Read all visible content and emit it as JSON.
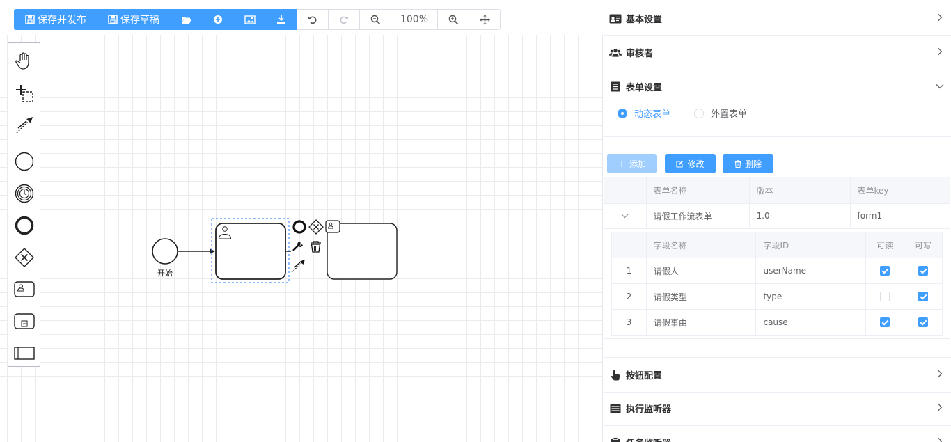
{
  "toolbar": {
    "save_publish": "保存并发布",
    "save_draft": "保存草稿",
    "zoom": "100%"
  },
  "palette": {
    "items": [
      "hand-tool",
      "lasso-tool",
      "connect-tool",
      "start-event",
      "timer-event",
      "end-event",
      "gateway",
      "user-task",
      "sub-process",
      "pool"
    ]
  },
  "diagram": {
    "start_label": "开始"
  },
  "panel": {
    "basic": "基本设置",
    "reviewer": "审核者",
    "form_settings": "表单设置",
    "radio_dynamic": "动态表单",
    "radio_external": "外置表单",
    "btn_add": "添加",
    "btn_edit": "修改",
    "btn_delete": "删除",
    "form_table": {
      "headers": [
        "表单名称",
        "版本",
        "表单key"
      ],
      "row": {
        "name": "请假工作流表单",
        "version": "1.0",
        "key": "form1"
      }
    },
    "field_table": {
      "headers": [
        "字段名称",
        "字段ID",
        "可读",
        "可写"
      ],
      "rows": [
        {
          "idx": "1",
          "name": "请假人",
          "id": "userName",
          "read": true,
          "write": true
        },
        {
          "idx": "2",
          "name": "请假类型",
          "id": "type",
          "read": false,
          "write": true
        },
        {
          "idx": "3",
          "name": "请假事由",
          "id": "cause",
          "read": true,
          "write": true
        }
      ]
    },
    "button_config": "按钮配置",
    "exec_listener": "执行监听器",
    "task_listener": "任务监听器"
  },
  "colors": {
    "accent": "#409eff",
    "accent_light": "#a0cfff"
  }
}
